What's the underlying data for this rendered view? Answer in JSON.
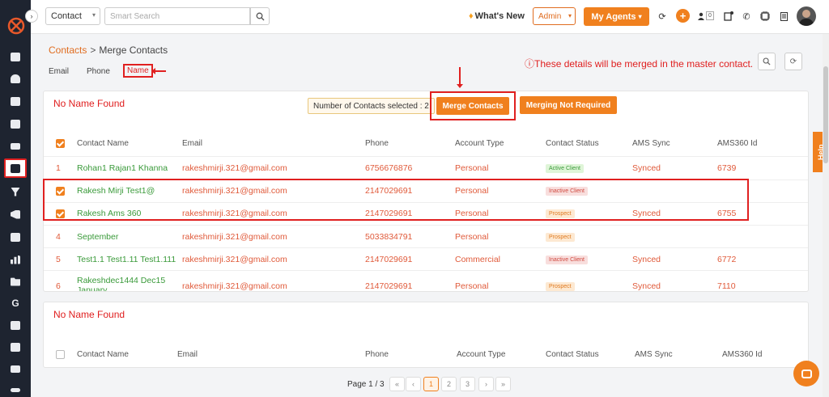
{
  "topbar": {
    "module_select": "Contact",
    "search_placeholder": "Smart Search",
    "whats_new": "What's New",
    "role_select": "Admin",
    "my_agents": "My Agents",
    "notif_badge": "0"
  },
  "sidebar": {
    "items": [
      "dashboard-icon",
      "users-icon",
      "documents-icon",
      "bank-icon",
      "list-icon",
      "contacts-icon",
      "filter-icon",
      "megaphone-icon",
      "report-icon",
      "chart-icon",
      "folder-icon",
      "G",
      "stack-icon",
      "calendar-icon",
      "mail-icon",
      "signature-icon"
    ]
  },
  "header": {
    "breadcrumb_root": "Contacts",
    "breadcrumb_sep": ">",
    "breadcrumb_current": "Merge Contacts",
    "tabs": [
      "Email",
      "Phone",
      "Name"
    ],
    "active_tab": "Name",
    "info_msg": "These details will be merged in the master contact."
  },
  "panel1": {
    "title": "No Name Found",
    "selected_count": "Number of Contacts selected : 2",
    "merge_btn": "Merge Contacts",
    "not_required_btn": "Merging Not Required",
    "columns": [
      "Contact Name",
      "Email",
      "Phone",
      "Account Type",
      "Contact Status",
      "AMS Sync",
      "AMS360 Id"
    ],
    "rows": [
      {
        "num": "1",
        "checked": false,
        "name": "Rohan1 Rajan1 Khanna",
        "email": "rakeshmirji.321@gmail.com",
        "phone": "6756676876",
        "account": "Personal",
        "status": "Active Client",
        "sync": "Synced",
        "id": "6739"
      },
      {
        "num": "",
        "checked": true,
        "name": "Rakesh Mirji Test1@",
        "email": "rakeshmirji.321@gmail.com",
        "phone": "2147029691",
        "account": "Personal",
        "status": "Inactive Client",
        "sync": "",
        "id": ""
      },
      {
        "num": "",
        "checked": true,
        "name": "Rakesh Ams 360",
        "email": "rakeshmirji.321@gmail.com",
        "phone": "2147029691",
        "account": "Personal",
        "status": "Prospect",
        "sync": "Synced",
        "id": "6755"
      },
      {
        "num": "4",
        "checked": false,
        "name": "September",
        "email": "rakeshmirji.321@gmail.com",
        "phone": "5033834791",
        "account": "Personal",
        "status": "Prospect",
        "sync": "",
        "id": ""
      },
      {
        "num": "5",
        "checked": false,
        "name": "Test1.1 Test1.11 Test1.111",
        "email": "rakeshmirji.321@gmail.com",
        "phone": "2147029691",
        "account": "Commercial",
        "status": "Inactive Client",
        "sync": "Synced",
        "id": "6772"
      },
      {
        "num": "6",
        "checked": false,
        "name": "Rakeshdec1444 Dec15 January",
        "email": "rakeshmirji.321@gmail.com",
        "phone": "2147029691",
        "account": "Personal",
        "status": "Prospect",
        "sync": "Synced",
        "id": "7110"
      }
    ]
  },
  "panel2": {
    "title": "No Name Found",
    "columns": [
      "Contact Name",
      "Email",
      "Phone",
      "Account Type",
      "Contact Status",
      "AMS Sync",
      "AMS360 Id"
    ]
  },
  "pagination": {
    "label": "Page 1 / 3",
    "first": "«",
    "prev": "‹",
    "pages": [
      "1",
      "2",
      "3"
    ],
    "next": "›",
    "last": "»",
    "current": "1"
  },
  "help_tab": "Help",
  "colors": {
    "accent": "#f0801e",
    "annotation": "#e02020",
    "sidebar": "#1e2430"
  }
}
